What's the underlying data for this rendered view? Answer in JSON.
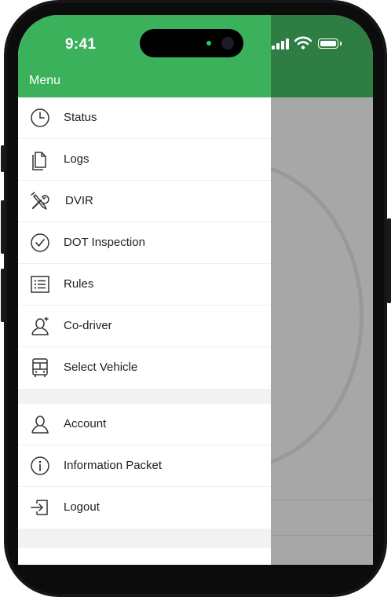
{
  "status_bar": {
    "time": "9:41"
  },
  "drawer": {
    "title": "Menu",
    "items": [
      {
        "label": "Status",
        "icon": "clock-icon"
      },
      {
        "label": "Logs",
        "icon": "document-icon"
      },
      {
        "label": "DVIR",
        "icon": "tools-icon"
      },
      {
        "label": "DOT Inspection",
        "icon": "check-circle-icon"
      },
      {
        "label": "Rules",
        "icon": "list-icon"
      },
      {
        "label": "Co-driver",
        "icon": "person-add-icon"
      },
      {
        "label": "Select Vehicle",
        "icon": "bus-icon"
      }
    ],
    "secondary_items": [
      {
        "label": "Account",
        "icon": "person-icon"
      },
      {
        "label": "Information Packet",
        "icon": "info-icon"
      },
      {
        "label": "Logout",
        "icon": "logout-icon"
      }
    ]
  },
  "colors": {
    "drawer_header": "#3bb15c",
    "app_header": "#2e7d43",
    "overlay": "#a7a7a7"
  }
}
